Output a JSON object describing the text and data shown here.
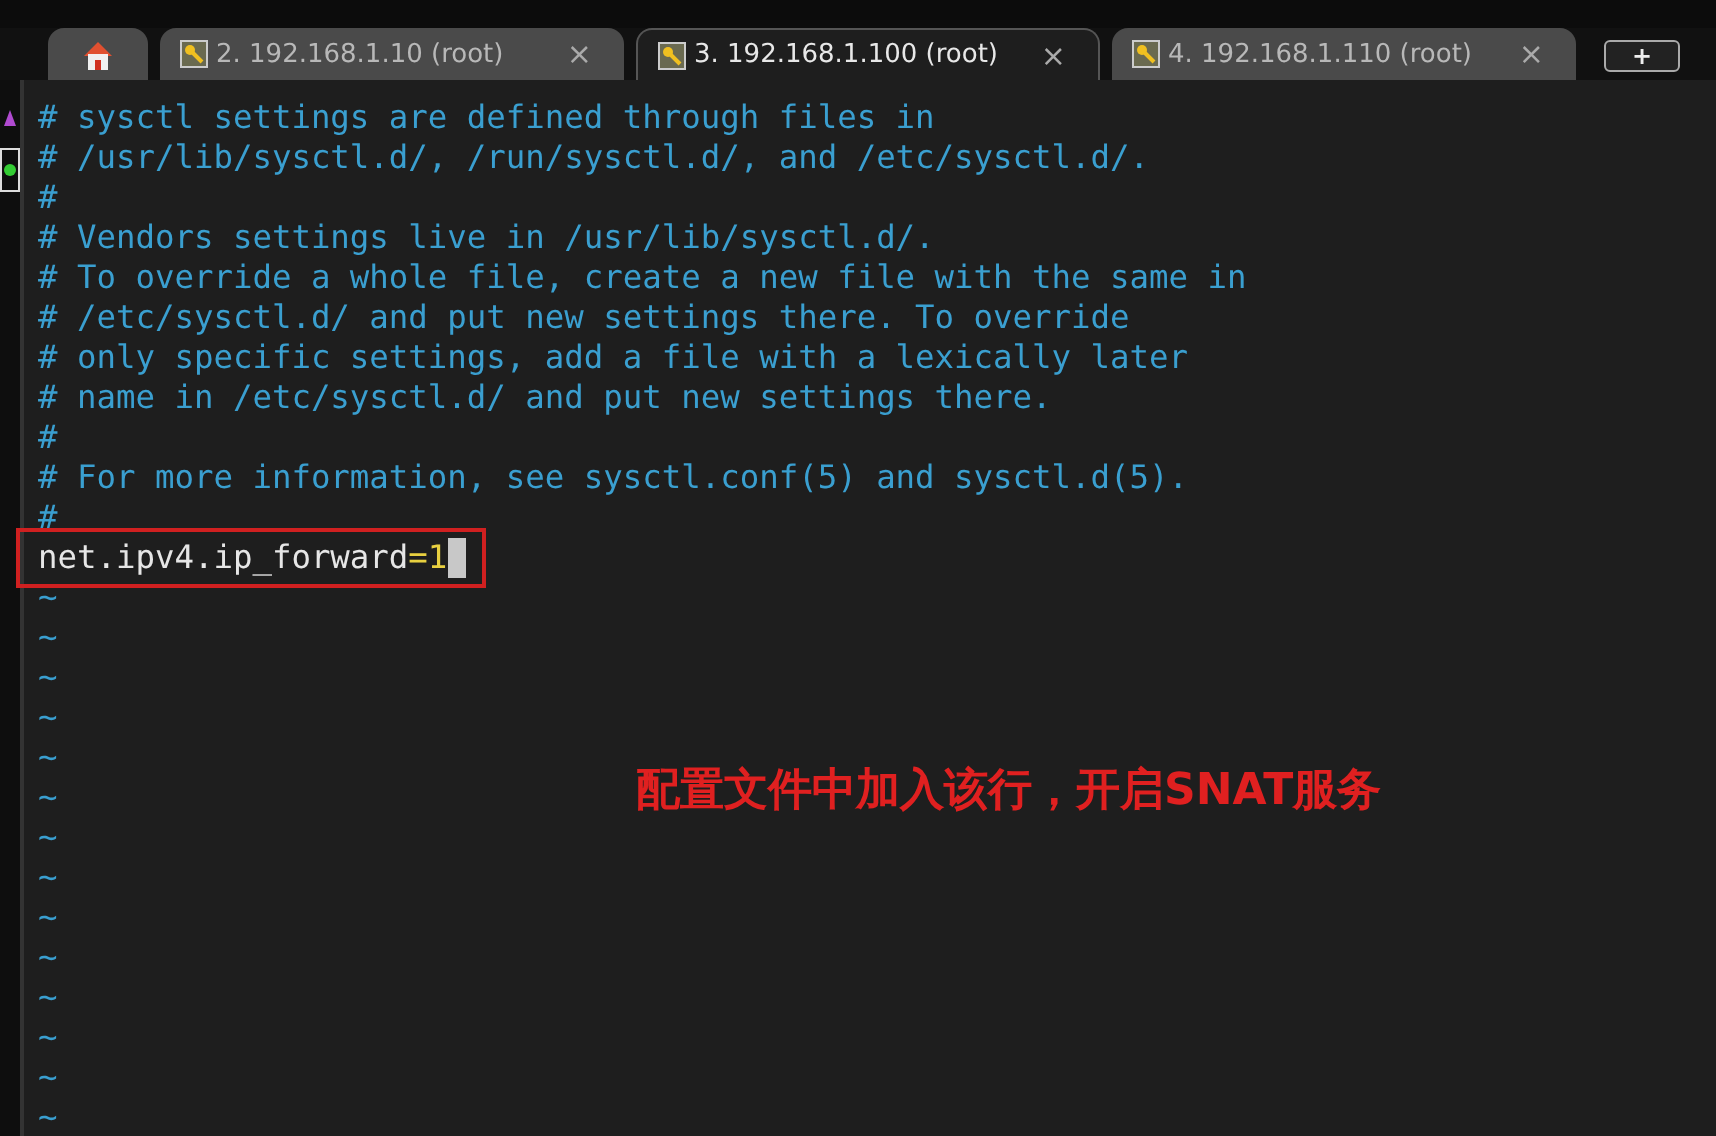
{
  "tabs": [
    {
      "kind": "home",
      "selected": false
    },
    {
      "kind": "session",
      "label": "2. 192.168.1.10 (root)",
      "close": "×",
      "selected": false
    },
    {
      "kind": "session",
      "label": "3. 192.168.1.100 (root)",
      "close": "×",
      "selected": true
    },
    {
      "kind": "session",
      "label": "4. 192.168.1.110 (root)",
      "close": "×",
      "selected": false
    }
  ],
  "new_tab": "+",
  "terminal": {
    "lines": [
      {
        "kind": "comment",
        "text": "# sysctl settings are defined through files in"
      },
      {
        "kind": "comment",
        "text": "# /usr/lib/sysctl.d/, /run/sysctl.d/, and /etc/sysctl.d/."
      },
      {
        "kind": "comment",
        "text": "#"
      },
      {
        "kind": "comment",
        "text": "# Vendors settings live in /usr/lib/sysctl.d/."
      },
      {
        "kind": "comment",
        "text": "# To override a whole file, create a new file with the same in"
      },
      {
        "kind": "comment",
        "text": "# /etc/sysctl.d/ and put new settings there. To override"
      },
      {
        "kind": "comment",
        "text": "# only specific settings, add a file with a lexically later"
      },
      {
        "kind": "comment",
        "text": "# name in /etc/sysctl.d/ and put new settings there."
      },
      {
        "kind": "comment",
        "text": "#"
      },
      {
        "kind": "comment",
        "text": "# For more information, see sysctl.conf(5) and sysctl.d(5)."
      },
      {
        "kind": "comment",
        "text": "#"
      },
      {
        "kind": "setting",
        "key": "net.ipv4.ip_forward",
        "op": "=",
        "value": "1",
        "highlighted": true,
        "cursor": true
      },
      {
        "kind": "tilde",
        "text": "~"
      },
      {
        "kind": "tilde",
        "text": "~"
      },
      {
        "kind": "tilde",
        "text": "~"
      },
      {
        "kind": "tilde",
        "text": "~"
      },
      {
        "kind": "tilde",
        "text": "~"
      },
      {
        "kind": "tilde",
        "text": "~"
      },
      {
        "kind": "tilde",
        "text": "~"
      },
      {
        "kind": "tilde",
        "text": "~"
      },
      {
        "kind": "tilde",
        "text": "~"
      },
      {
        "kind": "tilde",
        "text": "~"
      },
      {
        "kind": "tilde",
        "text": "~"
      },
      {
        "kind": "tilde",
        "text": "~"
      },
      {
        "kind": "tilde",
        "text": "~"
      },
      {
        "kind": "tilde",
        "text": "~"
      }
    ],
    "annotation": "配置文件中加入该行，开启SNAT服务"
  }
}
